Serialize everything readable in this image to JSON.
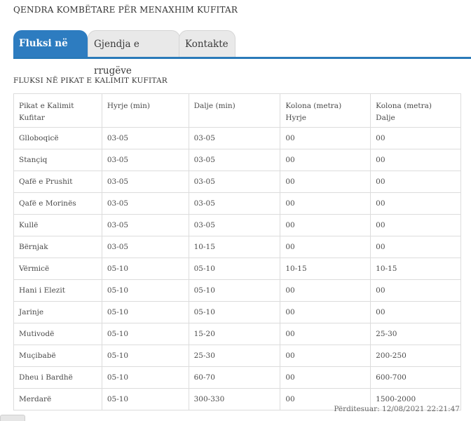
{
  "header": {
    "title": "QENDRA KOMBËTARE PËR MENAXHIM KUFITAR"
  },
  "tabs": [
    {
      "label": "Fluksi në kufi",
      "active": true
    },
    {
      "label": "Gjendja e rrugëve",
      "active": false
    },
    {
      "label": "Kontakte",
      "active": false
    }
  ],
  "section": {
    "title": "FLUKSI NË PIKAT E KALIMIT KUFITAR"
  },
  "table": {
    "headers": [
      [
        "Pikat e Kalimit",
        "Kufitar"
      ],
      [
        "Hyrje (min)",
        ""
      ],
      [
        "Dalje (min)",
        ""
      ],
      [
        "Kolona (metra)",
        "Hyrje"
      ],
      [
        "Kolona (metra)",
        "Dalje"
      ]
    ],
    "rows": [
      [
        "Glloboqicë",
        "03-05",
        "03-05",
        "00",
        "00"
      ],
      [
        "Stançiq",
        "03-05",
        "03-05",
        "00",
        "00"
      ],
      [
        "Qafë e Prushit",
        "03-05",
        "03-05",
        "00",
        "00"
      ],
      [
        "Qafë e Morinës",
        "03-05",
        "03-05",
        "00",
        "00"
      ],
      [
        "Kullë",
        "03-05",
        "03-05",
        "00",
        "00"
      ],
      [
        "Bërnjak",
        "03-05",
        "10-15",
        "00",
        "00"
      ],
      [
        "Vërmicë",
        "05-10",
        "05-10",
        "10-15",
        "10-15"
      ],
      [
        "Hani i Elezit",
        "05-10",
        "05-10",
        "00",
        "00"
      ],
      [
        "Jarinje",
        "05-10",
        "05-10",
        "00",
        "00"
      ],
      [
        "Mutivodë",
        "05-10",
        "15-20",
        "00",
        "25-30"
      ],
      [
        "Muçibabë",
        "05-10",
        "25-30",
        "00",
        "200-250"
      ],
      [
        "Dheu i Bardhë",
        "05-10",
        "60-70",
        "00",
        "600-700"
      ],
      [
        "Merdarë",
        "05-10",
        "300-330",
        "00",
        "1500-2000"
      ]
    ]
  },
  "footer": {
    "updated": "Përditesuar: 12/08/2021 22:21:47"
  },
  "colors": {
    "accent": "#2d7cc0",
    "tab_inactive": "#e9e9e9",
    "border": "#dcdcdc"
  }
}
